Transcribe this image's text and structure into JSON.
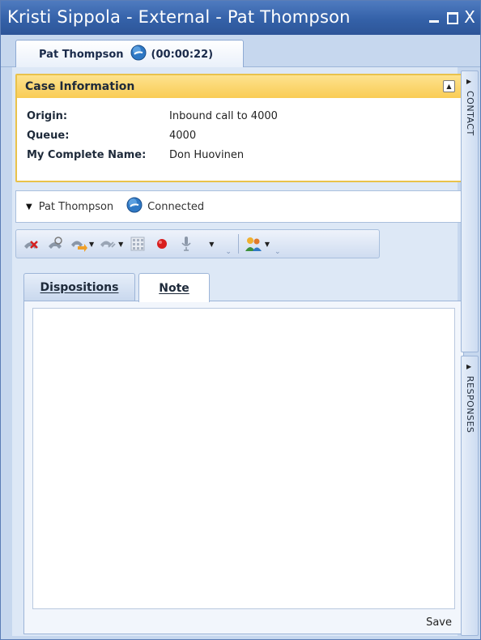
{
  "window": {
    "title": "Kristi Sippola - External - Pat Thompson",
    "controls": {
      "minimize": "_",
      "maximize": "□",
      "close": "X"
    }
  },
  "call_tab": {
    "party": "Pat Thompson",
    "timer": "(00:00:22)",
    "icon": "phone-globe-icon"
  },
  "case_information": {
    "header": "Case Information",
    "rows": [
      {
        "label": "Origin:",
        "value": "Inbound call to 4000"
      },
      {
        "label": "Queue:",
        "value": "4000"
      },
      {
        "label": "My Complete Name:",
        "value": "Don Huovinen"
      }
    ]
  },
  "party_bar": {
    "name": "Pat Thompson",
    "status": "Connected"
  },
  "toolbar": {
    "icons": [
      "disconnect-icon",
      "hold-icon",
      "transfer-icon",
      "conference-icon",
      "keypad-icon",
      "record-icon",
      "microphone-icon",
      "contacts-icon"
    ]
  },
  "subtabs": {
    "dispositions": "Dispositions",
    "note": "Note"
  },
  "note": {
    "value": "",
    "save_label": "Save"
  },
  "side_tabs": {
    "contact": "CONTACT",
    "responses": "RESPONSES"
  },
  "colors": {
    "titlebar": "#3461a8",
    "case_header": "#f9cc55",
    "case_border": "#e9c24b",
    "record": "#d81e1e"
  }
}
